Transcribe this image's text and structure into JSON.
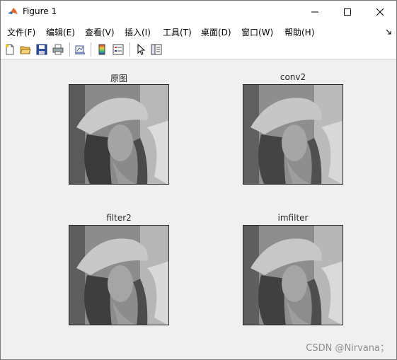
{
  "window": {
    "title": "Figure 1"
  },
  "menu": [
    {
      "label": "文件(F)"
    },
    {
      "label": "编辑(E)"
    },
    {
      "label": "查看(V)"
    },
    {
      "label": "插入(I)"
    },
    {
      "label": "工具(T)"
    },
    {
      "label": "桌面(D)"
    },
    {
      "label": "窗口(W)"
    },
    {
      "label": "帮助(H)"
    }
  ],
  "toolbar": {
    "icons": [
      "new-figure-icon",
      "open-file-icon",
      "save-icon",
      "print-icon",
      "link-plot-icon",
      "insert-colorbar-icon",
      "insert-legend-icon",
      "select-pointer-icon",
      "property-inspector-icon"
    ]
  },
  "subplots": [
    {
      "title": "原图",
      "image": "grayscale portrait (original)"
    },
    {
      "title": "conv2",
      "image": "grayscale portrait (filtered)"
    },
    {
      "title": "filter2",
      "image": "grayscale portrait (filtered)"
    },
    {
      "title": "imfilter",
      "image": "grayscale portrait (filtered)"
    }
  ],
  "watermark": "CSDN @Nirvana；"
}
